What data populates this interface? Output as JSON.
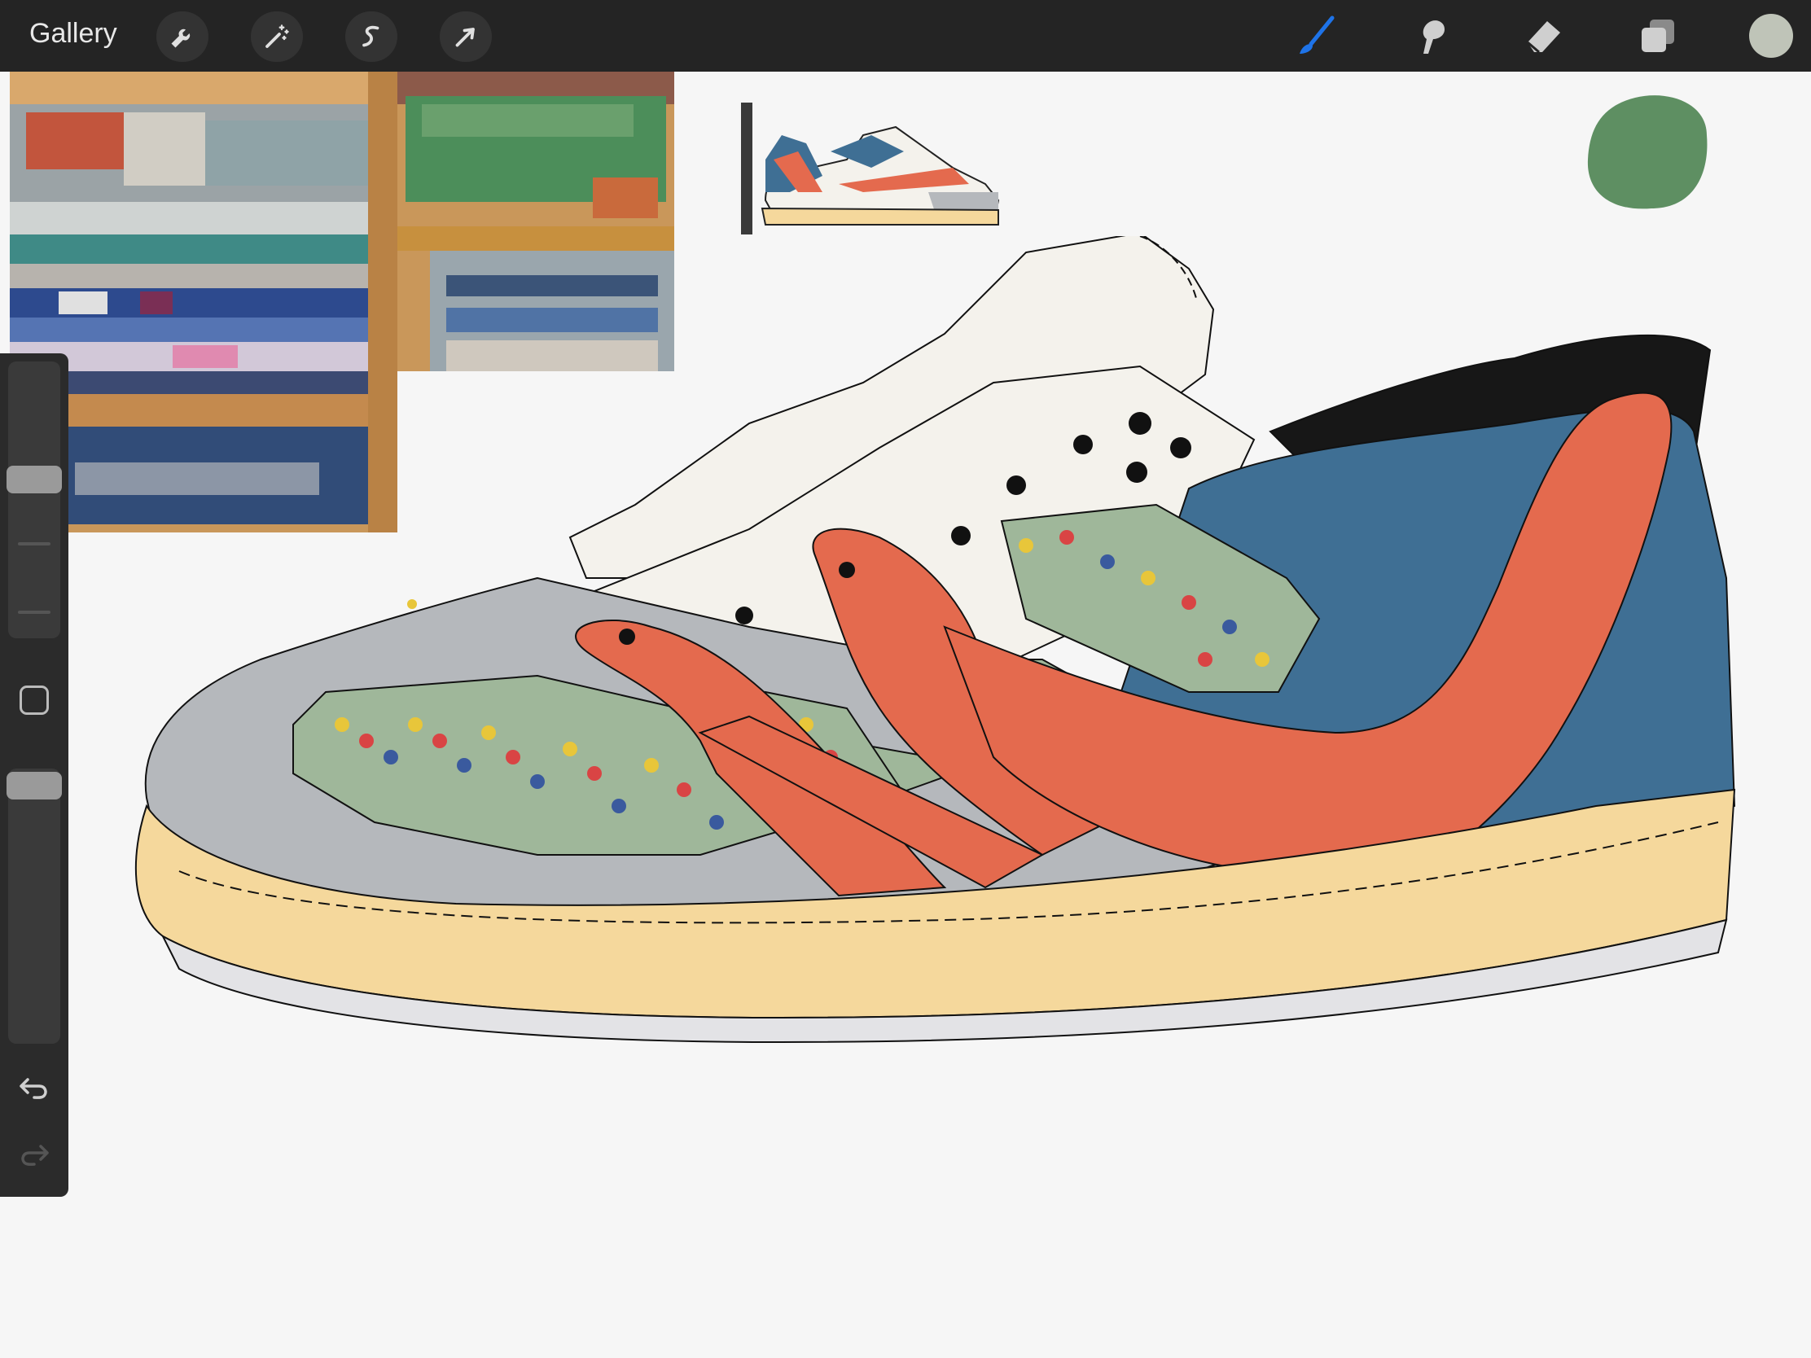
{
  "topbar": {
    "gallery_label": "Gallery",
    "left_tools": [
      {
        "icon": "wrench-icon"
      },
      {
        "icon": "magic-wand-icon"
      },
      {
        "icon": "selection-s-icon"
      },
      {
        "icon": "transform-arrow-icon"
      }
    ],
    "right_tools": [
      {
        "icon": "brush-icon",
        "active_color": "#1e73e8"
      },
      {
        "icon": "smudge-icon"
      },
      {
        "icon": "eraser-icon"
      },
      {
        "icon": "layers-icon"
      }
    ],
    "current_color": "#bfc4b8"
  },
  "sidebar": {
    "brush_size_icon": "slider",
    "opacity_icon": "slider",
    "modify_icon": "square-modifier-icon",
    "undo_icon": "undo-icon",
    "redo_icon": "redo-icon"
  },
  "canvas": {
    "colors": {
      "sole": "#f5d89c",
      "toe": "#b5b8bc",
      "overlay": "#e46a4e",
      "heel": "#3f6f94",
      "collar": "#171717",
      "tongue": "#f4f2ec",
      "blob": "#5e8f62"
    }
  }
}
